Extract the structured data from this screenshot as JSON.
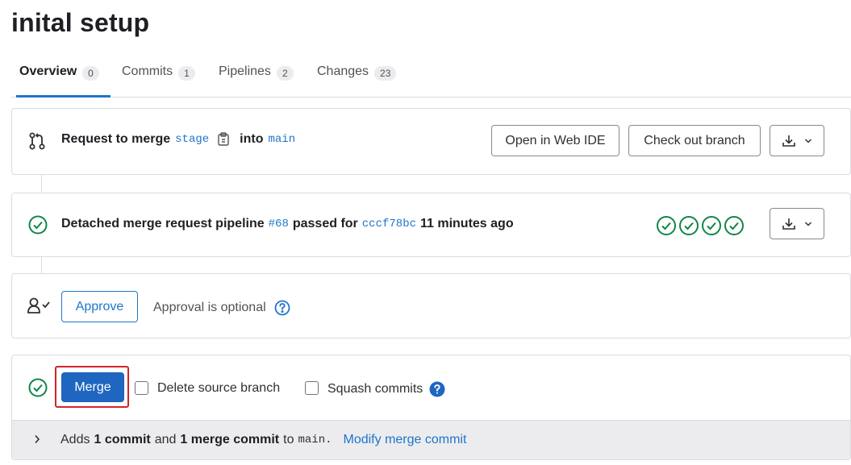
{
  "page": {
    "title": "inital setup"
  },
  "tabs": [
    {
      "label": "Overview",
      "count": "0"
    },
    {
      "label": "Commits",
      "count": "1"
    },
    {
      "label": "Pipelines",
      "count": "2"
    },
    {
      "label": "Changes",
      "count": "23"
    }
  ],
  "merge_request": {
    "prefix": "Request to merge",
    "source_branch": "stage",
    "into": "into",
    "target_branch": "main",
    "open_ide_label": "Open in Web IDE",
    "checkout_label": "Check out branch"
  },
  "pipeline": {
    "text_prefix": "Detached merge request pipeline",
    "id": "#68",
    "passed_for": "passed for",
    "commit": "cccf78bc",
    "time": "11 minutes ago",
    "stage_count": 4
  },
  "approval": {
    "approve_label": "Approve",
    "status": "Approval is optional"
  },
  "merge": {
    "merge_label": "Merge",
    "delete_source_label": "Delete source branch",
    "squash_label": "Squash commits"
  },
  "footer": {
    "adds": "Adds",
    "commits": "1 commit",
    "and": "and",
    "merge_commits": "1 merge commit",
    "to": "to",
    "branch": "main.",
    "modify_link": "Modify merge commit"
  },
  "colors": {
    "success": "#108548",
    "link": "#1f75cb",
    "primary": "#1f66c1",
    "highlight": "#d0242c"
  }
}
